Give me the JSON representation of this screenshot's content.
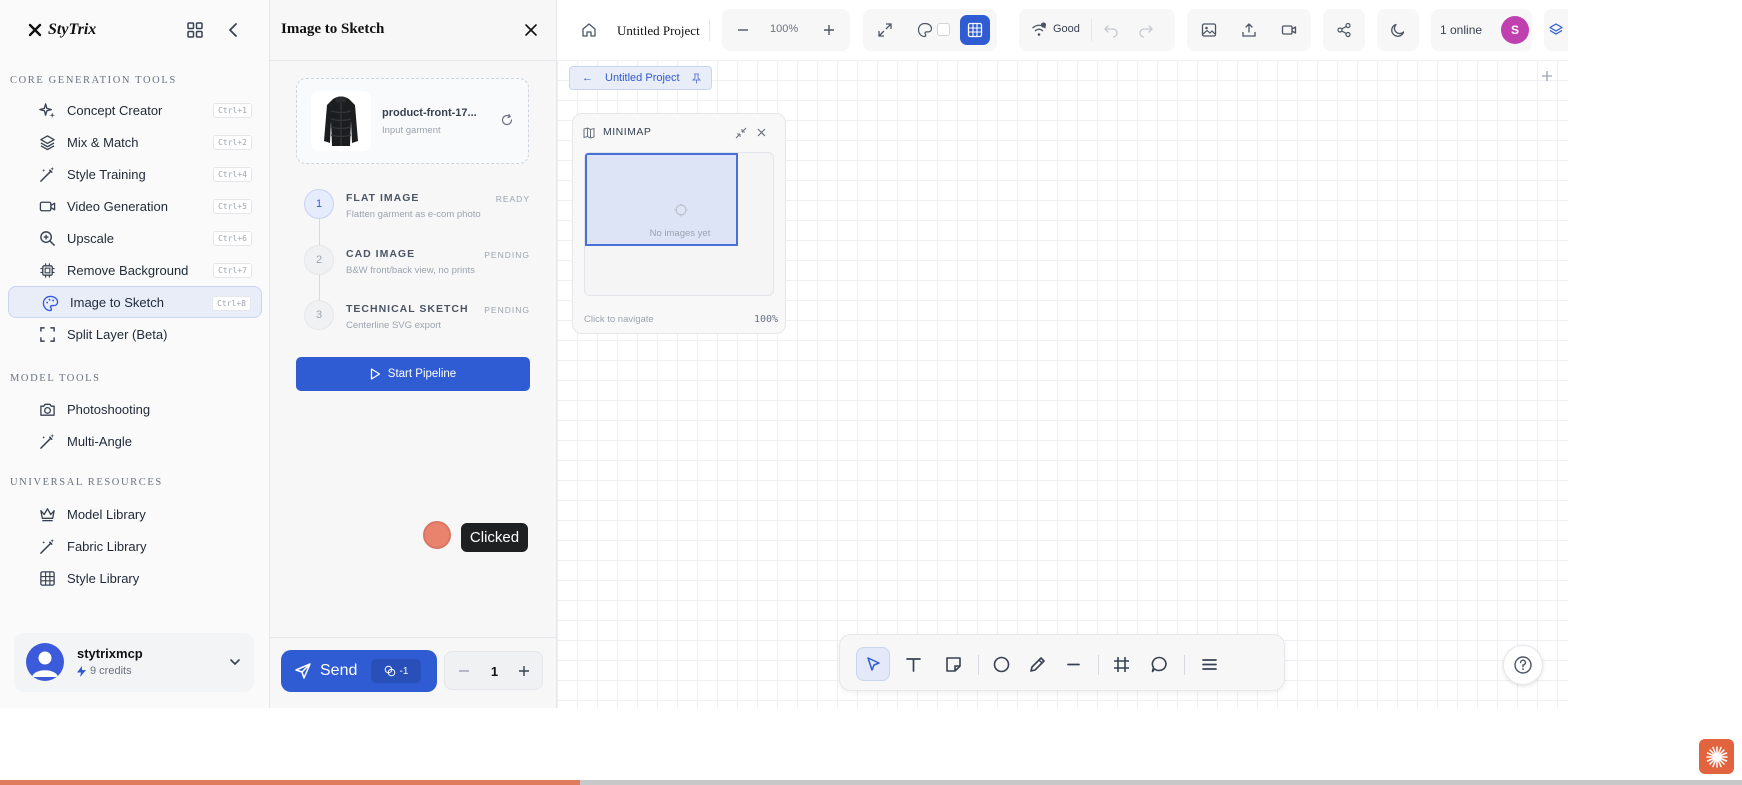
{
  "app": {
    "name": "StyTrix"
  },
  "sidebar": {
    "sections": [
      {
        "title": "CORE GENERATION TOOLS"
      },
      {
        "title": "MODEL TOOLS"
      },
      {
        "title": "UNIVERSAL RESOURCES"
      }
    ],
    "core_items": [
      {
        "label": "Concept Creator",
        "shortcut": "Ctrl+1",
        "icon": "sparkles-icon"
      },
      {
        "label": "Mix & Match",
        "shortcut": "Ctrl+2",
        "icon": "layers-icon"
      },
      {
        "label": "Style Training",
        "shortcut": "Ctrl+4",
        "icon": "magic-wand-icon"
      },
      {
        "label": "Video Generation",
        "shortcut": "Ctrl+5",
        "icon": "video-icon"
      },
      {
        "label": "Upscale",
        "shortcut": "Ctrl+6",
        "icon": "zoom-in-icon"
      },
      {
        "label": "Remove Background",
        "shortcut": "Ctrl+7",
        "icon": "chip-icon"
      },
      {
        "label": "Image to Sketch",
        "shortcut": "Ctrl+8",
        "icon": "palette-icon"
      },
      {
        "label": "Split Layer (Beta)",
        "icon": "scan-icon"
      }
    ],
    "model_items": [
      {
        "label": "Photoshooting",
        "icon": "camera-icon"
      },
      {
        "label": "Multi-Angle",
        "icon": "magic-wand-icon"
      }
    ],
    "resource_items": [
      {
        "label": "Model Library",
        "icon": "crown-icon"
      },
      {
        "label": "Fabric Library",
        "icon": "magic-wand-icon"
      },
      {
        "label": "Style Library",
        "icon": "table-icon"
      }
    ],
    "user": {
      "name": "stytrixmcp",
      "credits": "9 credits"
    }
  },
  "panel": {
    "title": "Image to Sketch",
    "input": {
      "file_name": "product-front-17...",
      "subtitle": "Input garment"
    },
    "steps": [
      {
        "num": "1",
        "title": "FLAT IMAGE",
        "status": "READY",
        "desc": "Flatten garment as e-com photo"
      },
      {
        "num": "2",
        "title": "CAD IMAGE",
        "status": "PENDING",
        "desc": "B&W front/back view, no prints"
      },
      {
        "num": "3",
        "title": "TECHNICAL SKETCH",
        "status": "PENDING",
        "desc": "Centerline SVG export"
      }
    ],
    "start_label": "Start Pipeline",
    "clicked_label": "Clicked",
    "send_label": "Send",
    "send_cost": "-1",
    "quantity": "1"
  },
  "topbar": {
    "project_name": "Untitled Project",
    "zoom": "100%",
    "connection": "Good",
    "online": "1 online",
    "user_initial": "S"
  },
  "canvas": {
    "tab_label": "Untitled Project",
    "tab_prefix": "←"
  },
  "minimap": {
    "title": "MINIMAP",
    "empty_text": "No images yet",
    "nav_hint": "Click to navigate",
    "zoom": "100%"
  },
  "progress": {
    "fraction": 0.333
  },
  "colors": {
    "accent": "#2f5bd3",
    "progress": "#e07a5c",
    "badge": "#e2643e",
    "user_bubble": "#c040b0"
  }
}
